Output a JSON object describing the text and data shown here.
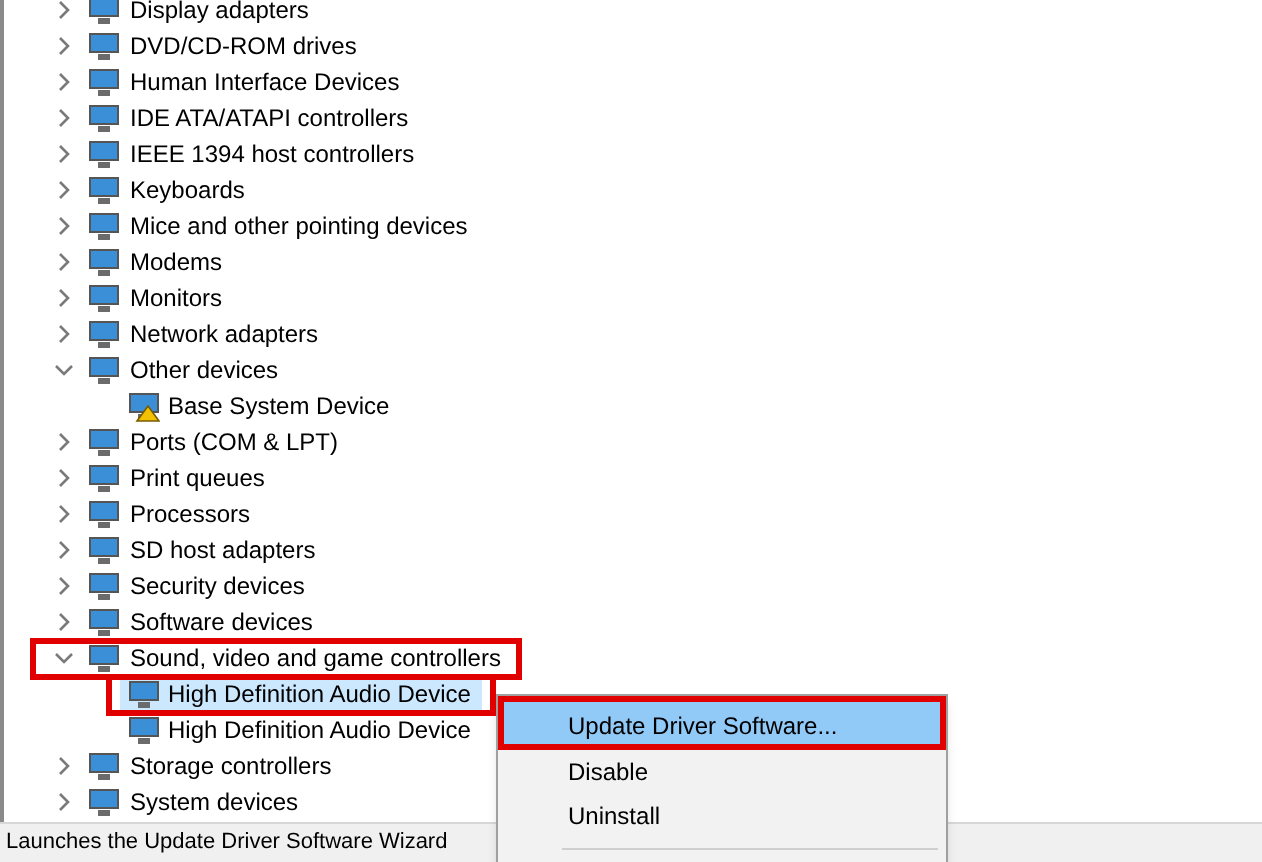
{
  "tree": [
    {
      "label": "Display adapters",
      "expanded": false
    },
    {
      "label": "DVD/CD-ROM drives",
      "expanded": false
    },
    {
      "label": "Human Interface Devices",
      "expanded": false
    },
    {
      "label": "IDE ATA/ATAPI controllers",
      "expanded": false
    },
    {
      "label": "IEEE 1394 host controllers",
      "expanded": false
    },
    {
      "label": "Keyboards",
      "expanded": false
    },
    {
      "label": "Mice and other pointing devices",
      "expanded": false
    },
    {
      "label": "Modems",
      "expanded": false
    },
    {
      "label": "Monitors",
      "expanded": false
    },
    {
      "label": "Network adapters",
      "expanded": false
    },
    {
      "label": "Other devices",
      "expanded": true,
      "children": [
        {
          "label": "Base System Device",
          "selected": false,
          "warning": true
        }
      ]
    },
    {
      "label": "Ports (COM & LPT)",
      "expanded": false
    },
    {
      "label": "Print queues",
      "expanded": false
    },
    {
      "label": "Processors",
      "expanded": false
    },
    {
      "label": "SD host adapters",
      "expanded": false
    },
    {
      "label": "Security devices",
      "expanded": false
    },
    {
      "label": "Software devices",
      "expanded": false
    },
    {
      "label": "Sound, video and game controllers",
      "expanded": true,
      "children": [
        {
          "label": "High Definition Audio Device",
          "selected": true,
          "warning": false
        },
        {
          "label": "High Definition Audio Device",
          "selected": false,
          "warning": false
        }
      ]
    },
    {
      "label": "Storage controllers",
      "expanded": false
    },
    {
      "label": "System devices",
      "expanded": false
    }
  ],
  "context_menu": [
    {
      "label": "Update Driver Software...",
      "selected": true
    },
    {
      "label": "Disable",
      "selected": false
    },
    {
      "label": "Uninstall",
      "selected": false
    }
  ],
  "status_bar": "Launches the Update Driver Software Wizard"
}
